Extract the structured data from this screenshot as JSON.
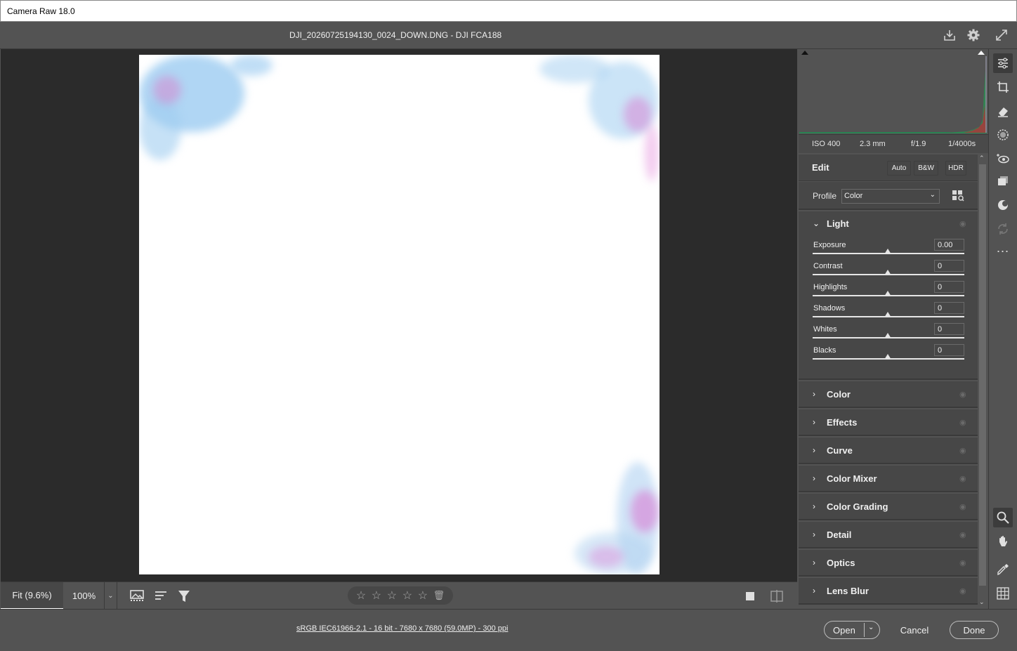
{
  "window": {
    "title": "Camera Raw 18.0"
  },
  "header": {
    "filename": "DJI_20260725194130_0024_DOWN.DNG  -  DJI FCA188",
    "icons": [
      "save-icon",
      "gear-icon",
      "fullscreen-icon"
    ]
  },
  "histogram": {
    "iso": "ISO 400",
    "focal": "2.3 mm",
    "aperture": "f/1.9",
    "shutter": "1/4000s"
  },
  "edit": {
    "label": "Edit",
    "auto_label": "Auto",
    "bw_label": "B&W",
    "hdr_label": "HDR",
    "profile_label": "Profile",
    "profile_value": "Color"
  },
  "light": {
    "title": "Light",
    "sliders": [
      {
        "label": "Exposure",
        "value": "0.00"
      },
      {
        "label": "Contrast",
        "value": "0"
      },
      {
        "label": "Highlights",
        "value": "0"
      },
      {
        "label": "Shadows",
        "value": "0"
      },
      {
        "label": "Whites",
        "value": "0"
      },
      {
        "label": "Blacks",
        "value": "0"
      }
    ]
  },
  "sections": [
    "Color",
    "Effects",
    "Curve",
    "Color Mixer",
    "Color Grading",
    "Detail",
    "Optics",
    "Lens Blur"
  ],
  "bottom": {
    "zoom_fit": "Fit (9.6%)",
    "zoom_100": "100%",
    "file_info": "sRGB IEC61966-2.1 - 16 bit - 7680 x 7680 (59.0MP) - 300 ppi"
  },
  "footer": {
    "open_label": "Open",
    "cancel_label": "Cancel",
    "done_label": "Done"
  }
}
